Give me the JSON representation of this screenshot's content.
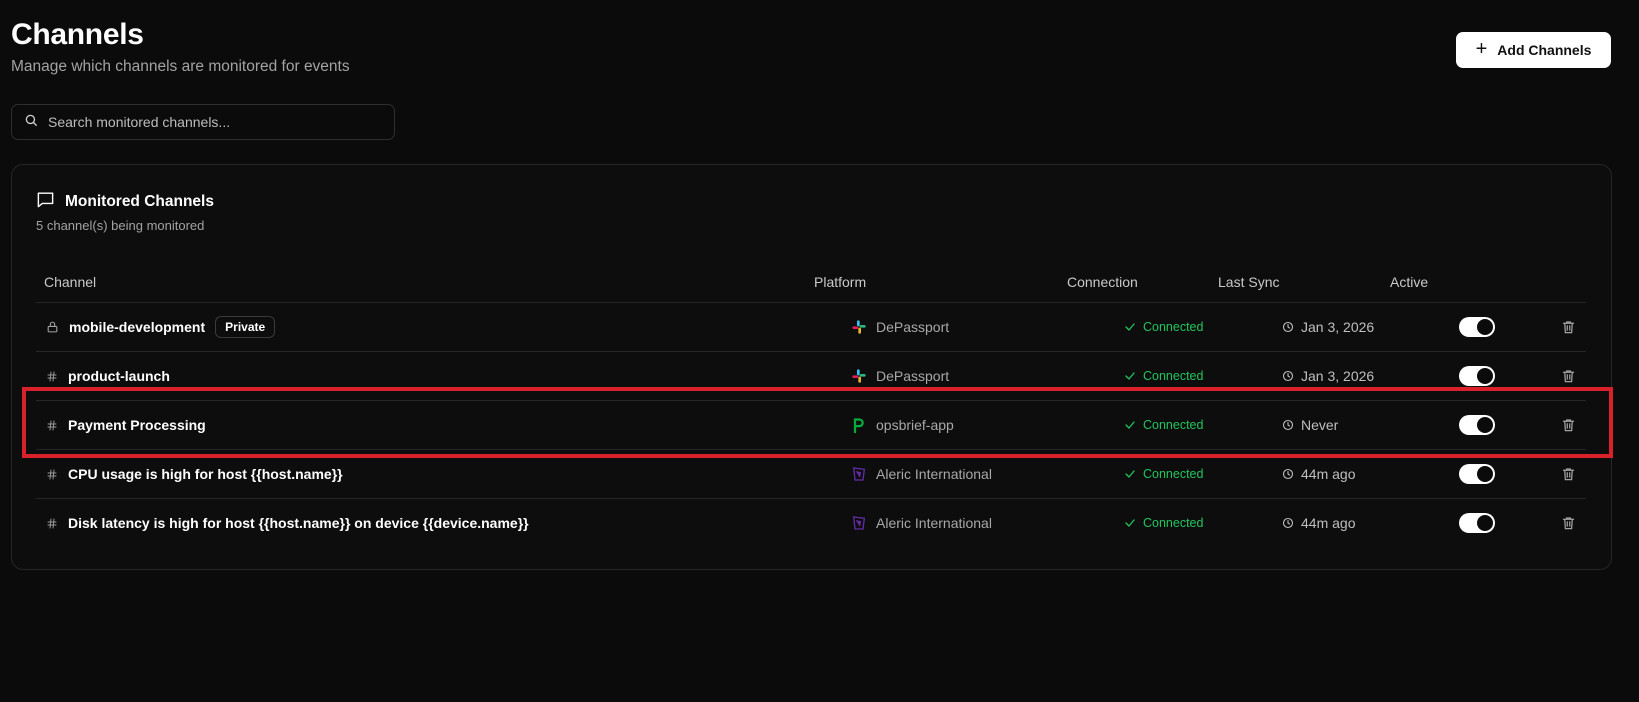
{
  "header": {
    "title": "Channels",
    "subtitle": "Manage which channels are monitored for events",
    "add_button_label": "Add Channels"
  },
  "search": {
    "placeholder": "Search monitored channels..."
  },
  "card": {
    "title": "Monitored Channels",
    "subtitle": "5 channel(s) being monitored"
  },
  "table": {
    "columns": {
      "channel": "Channel",
      "platform": "Platform",
      "connection": "Connection",
      "last_sync": "Last Sync",
      "active": "Active"
    },
    "rows": [
      {
        "icon": "lock-icon",
        "name": "mobile-development",
        "badge": "Private",
        "platform_icon": "slack-icon",
        "platform": "DePassport",
        "connection": "Connected",
        "last_sync": "Jan 3, 2026",
        "active": true
      },
      {
        "icon": "hash-icon",
        "name": "product-launch",
        "platform_icon": "slack-icon",
        "platform": "DePassport",
        "connection": "Connected",
        "last_sync": "Jan 3, 2026",
        "active": true
      },
      {
        "icon": "hash-icon",
        "name": "Payment Processing",
        "platform_icon": "pagerduty-icon",
        "platform": "opsbrief-app",
        "connection": "Connected",
        "last_sync": "Never",
        "active": true
      },
      {
        "icon": "hash-icon",
        "name": "CPU usage is high for host {{host.name}}",
        "platform_icon": "datadog-icon",
        "platform": "Aleric International",
        "connection": "Connected",
        "last_sync": "44m ago",
        "active": true
      },
      {
        "icon": "hash-icon",
        "name": "Disk latency is high for host {{host.name}} on device {{device.name}}",
        "platform_icon": "datadog-icon",
        "platform": "Aleric International",
        "connection": "Connected",
        "last_sync": "44m ago",
        "active": true
      }
    ]
  },
  "colors": {
    "background": "#0b0b0b",
    "connected": "#22c55e",
    "highlight": "#d9212c",
    "pagerduty": "#06ac38",
    "datadog": "#632ca6"
  }
}
